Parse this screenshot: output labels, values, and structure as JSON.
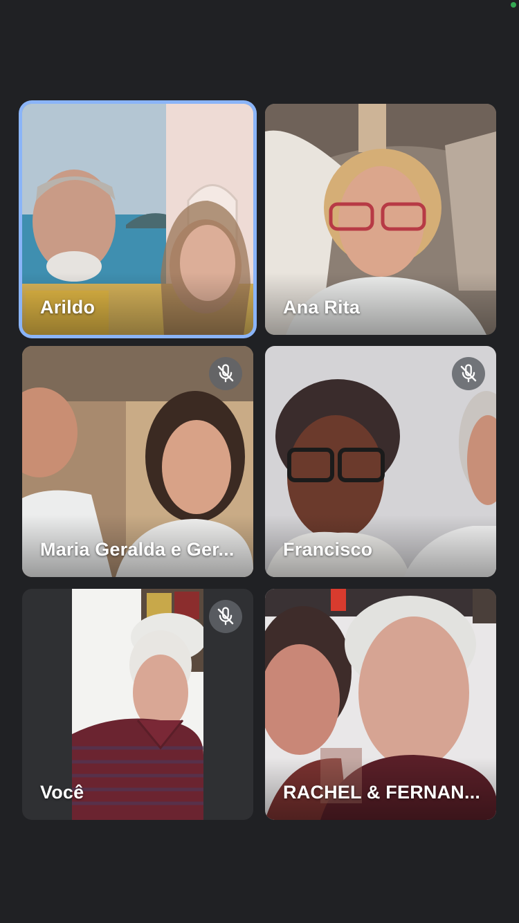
{
  "status": {
    "indicator_color": "#34a853"
  },
  "accent_color": "#8ab4f8",
  "participants": [
    {
      "name": "Arildo",
      "muted": false,
      "active_speaker": true
    },
    {
      "name": "Ana Rita",
      "muted": false,
      "active_speaker": false
    },
    {
      "name": "Maria Geralda e Ger...",
      "muted": true,
      "active_speaker": false
    },
    {
      "name": "Francisco",
      "muted": true,
      "active_speaker": false
    },
    {
      "name": "Você",
      "muted": true,
      "active_speaker": false
    },
    {
      "name": "RACHEL & FERNAN...",
      "muted": false,
      "active_speaker": false
    }
  ],
  "icons": {
    "mute": "mic-off-icon"
  }
}
